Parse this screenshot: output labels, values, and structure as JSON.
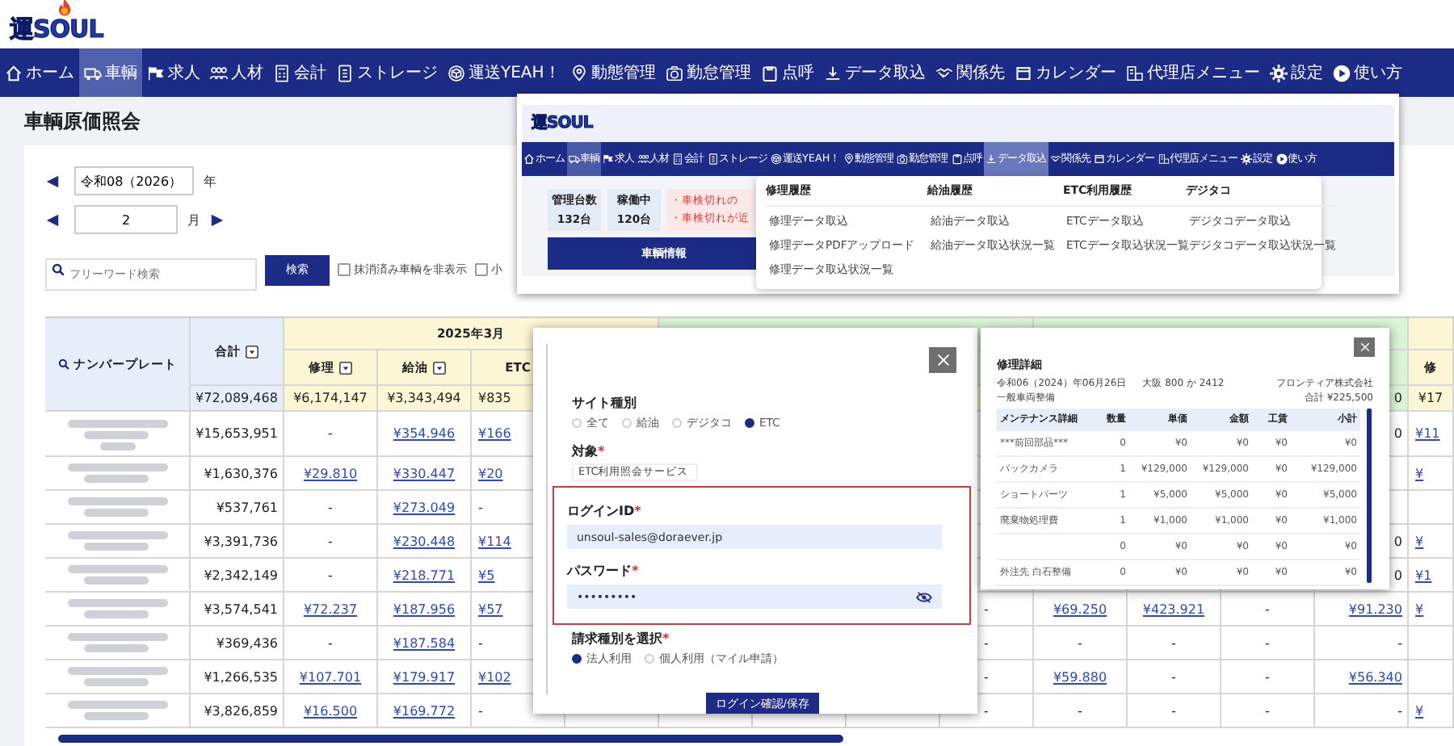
{
  "logo": "運SOUL",
  "nav": [
    {
      "label": "ホーム",
      "selected": false
    },
    {
      "label": "車輌",
      "selected": true
    },
    {
      "label": "求人",
      "selected": false
    },
    {
      "label": "人材",
      "selected": false
    },
    {
      "label": "会計",
      "selected": false
    },
    {
      "label": "ストレージ",
      "selected": false
    },
    {
      "label": "運送YEAH！",
      "selected": false
    },
    {
      "label": "動態管理",
      "selected": false
    },
    {
      "label": "勤怠管理",
      "selected": false
    },
    {
      "label": "点呼",
      "selected": false
    },
    {
      "label": "データ取込",
      "selected": false
    },
    {
      "label": "関係先",
      "selected": false
    },
    {
      "label": "カレンダー",
      "selected": false
    },
    {
      "label": "代理店メニュー",
      "selected": false
    },
    {
      "label": "設定",
      "selected": false
    },
    {
      "label": "使い方",
      "selected": false
    }
  ],
  "page_title": "車輌原価照会",
  "year": {
    "value": "令和08（2026）",
    "unit": "年"
  },
  "month": {
    "value": "2",
    "unit": "月"
  },
  "search": {
    "placeholder": "フリーワード検索",
    "button": "検索"
  },
  "filters": [
    {
      "label": "抹消済み車輌を非表示",
      "checked": false
    },
    {
      "label": "小",
      "checked": false
    }
  ],
  "table": {
    "plate_header": "ナンバープレート",
    "total_header": {
      "label": "合計",
      "filter": true
    },
    "month_header": "2025年3月",
    "subheaders": [
      {
        "label": "修理",
        "filter": true
      },
      {
        "label": "給油",
        "filter": true
      },
      {
        "label": "ETC",
        "filter": false
      }
    ],
    "edge_subheader": "修",
    "totals": {
      "cells": [
        "¥72,089,468",
        "¥6,174,147",
        "¥3,343,494",
        "¥835"
      ],
      "tail": [
        "0"
      ],
      "edge": "¥17"
    },
    "rows": [
      {
        "cells": [
          "¥15,653,951",
          "-",
          {
            "link": "¥354.946"
          },
          {
            "link": "¥166"
          }
        ],
        "tail": [
          "0"
        ],
        "edge": {
          "link": "¥11"
        }
      },
      {
        "cells": [
          "¥1,630,376",
          {
            "link": "¥29.810"
          },
          {
            "link": "¥330.447"
          },
          {
            "link": "¥20"
          }
        ],
        "edge": {
          "link": "¥"
        }
      },
      {
        "cells": [
          "¥537,761",
          "-",
          {
            "link": "¥273.049"
          },
          "-"
        ]
      },
      {
        "cells": [
          "¥3,391,736",
          "-",
          {
            "link": "¥230.448"
          },
          {
            "link": "¥114"
          }
        ],
        "tail": [
          "0"
        ],
        "edge": {
          "link": "¥"
        }
      },
      {
        "cells": [
          "¥2,342,149",
          "-",
          {
            "link": "¥218.771"
          },
          {
            "link": "¥5"
          }
        ],
        "tail": [
          "0"
        ],
        "edge": {
          "link": "¥1"
        }
      },
      {
        "cells": [
          "¥3,574,541",
          {
            "link": "¥72.237"
          },
          {
            "link": "¥187.956"
          },
          {
            "link": "¥57"
          }
        ],
        "tail": [
          "-",
          {
            "link": "¥69.250"
          },
          {
            "link": "¥423.921"
          },
          "-",
          {
            "link": "¥91.230"
          }
        ],
        "edge": {
          "link": "¥"
        }
      },
      {
        "cells": [
          "¥369,436",
          "-",
          {
            "link": "¥187.584"
          },
          "-"
        ],
        "tail": [
          "-",
          "-",
          "-",
          "-",
          "-"
        ]
      },
      {
        "cells": [
          "¥1,266,535",
          {
            "link": "¥107.701"
          },
          {
            "link": "¥179.917"
          },
          {
            "link": "¥102"
          }
        ],
        "tail": [
          "-",
          {
            "link": "¥59.880"
          },
          "-",
          "-",
          {
            "link": "¥56.340"
          }
        ]
      },
      {
        "cells": [
          "¥3,826,859",
          {
            "link": "¥16.500"
          },
          {
            "link": "¥169.772"
          },
          "-"
        ],
        "tail": [
          "-",
          "-",
          "-",
          "-",
          "-"
        ],
        "edge": {
          "link": "¥"
        }
      }
    ]
  },
  "menu_screenshot": {
    "logo": "運SOUL",
    "nav": [
      {
        "label": "ホーム",
        "selected": false,
        "open": false
      },
      {
        "label": "車輌",
        "selected": true,
        "open": false
      },
      {
        "label": "求人",
        "selected": false,
        "open": false
      },
      {
        "label": "人材",
        "selected": false,
        "open": false
      },
      {
        "label": "会計",
        "selected": false,
        "open": false
      },
      {
        "label": "ストレージ",
        "selected": false,
        "open": false
      },
      {
        "label": "運送YEAH！",
        "selected": false,
        "open": false
      },
      {
        "label": "動態管理",
        "selected": false,
        "open": false
      },
      {
        "label": "勤怠管理",
        "selected": false,
        "open": false
      },
      {
        "label": "点呼",
        "selected": false,
        "open": false
      },
      {
        "label": "データ取込",
        "selected": false,
        "open": true
      },
      {
        "label": "関係先",
        "selected": false,
        "open": false
      },
      {
        "label": "カレンダー",
        "selected": false,
        "open": false
      },
      {
        "label": "代理店メニュー",
        "selected": false,
        "open": false
      },
      {
        "label": "設定",
        "selected": false,
        "open": false
      },
      {
        "label": "使い方",
        "selected": false,
        "open": false
      }
    ],
    "dropdown": [
      {
        "heading": "修理履歴",
        "items": [
          "修理データ取込",
          "修理データPDFアップロード",
          "修理データ取込状況一覧"
        ]
      },
      {
        "heading": "給油履歴",
        "items": [
          "給油データ取込",
          "給油データ取込状況一覧"
        ]
      },
      {
        "heading": "ETC利用履歴",
        "items": [
          "ETCデータ取込",
          "ETCデータ取込状況一覧"
        ]
      },
      {
        "heading": "デジタコ",
        "items": [
          "デジタコデータ取込",
          "デジタコデータ取込状況一覧"
        ]
      }
    ],
    "stats": [
      {
        "label": "管理台数",
        "value": "132台"
      },
      {
        "label": "稼働中",
        "value": "120台"
      }
    ],
    "notices": [
      "・車検切れの",
      "・車検切れが近"
    ],
    "tab": "車輌情報"
  },
  "login_modal": {
    "site_type": {
      "label": "サイト種別",
      "options": [
        {
          "label": "全て",
          "selected": false
        },
        {
          "label": "給油",
          "selected": false
        },
        {
          "label": "デジタコ",
          "selected": false
        },
        {
          "label": "ETC",
          "selected": true
        }
      ]
    },
    "target": {
      "label": "対象",
      "mark": "*",
      "value": "ETC利用照会サービス"
    },
    "highlight_credentials": true,
    "login_id": {
      "label": "ログインID",
      "mark": "*",
      "value": "unsoul-sales@doraever.jp"
    },
    "password": {
      "label": "パスワード",
      "mark": "*",
      "value": "•••••••••"
    },
    "billing": {
      "label": "請求種別を選択",
      "mark": "*",
      "options": [
        {
          "label": "法人利用",
          "selected": true
        },
        {
          "label": "個人利用（マイル申請）",
          "selected": false
        }
      ]
    },
    "submit": "ログイン確認/保存"
  },
  "repair_detail": {
    "title": "修理詳細",
    "date": "令和06（2024）年06月26日",
    "plate": "大阪 800 か 2412",
    "company": "フロンティア株式会社",
    "category": "一般車両整備",
    "total": "合計 ¥225,500",
    "columns": [
      "メンテナンス詳細",
      "数量",
      "単価",
      "金額",
      "工賃",
      "小計"
    ],
    "rows": [
      {
        "item": "***前回部品***",
        "values": [
          "0",
          "¥0",
          "¥0",
          "¥0",
          "¥0"
        ]
      },
      {
        "item": "バックカメラ",
        "values": [
          "1",
          "¥129,000",
          "¥129,000",
          "¥0",
          "¥129,000"
        ]
      },
      {
        "item": "ショートパーツ",
        "values": [
          "1",
          "¥5,000",
          "¥5,000",
          "¥0",
          "¥5,000"
        ]
      },
      {
        "item": "廃棄物処理費",
        "values": [
          "1",
          "¥1,000",
          "¥1,000",
          "¥0",
          "¥1,000"
        ]
      },
      {
        "values": [
          "0",
          "¥0",
          "¥0",
          "¥0",
          "¥0"
        ]
      },
      {
        "item": "外注先 白石整備",
        "values": [
          "0",
          "¥0",
          "¥0",
          "¥0",
          "¥0"
        ]
      }
    ]
  }
}
